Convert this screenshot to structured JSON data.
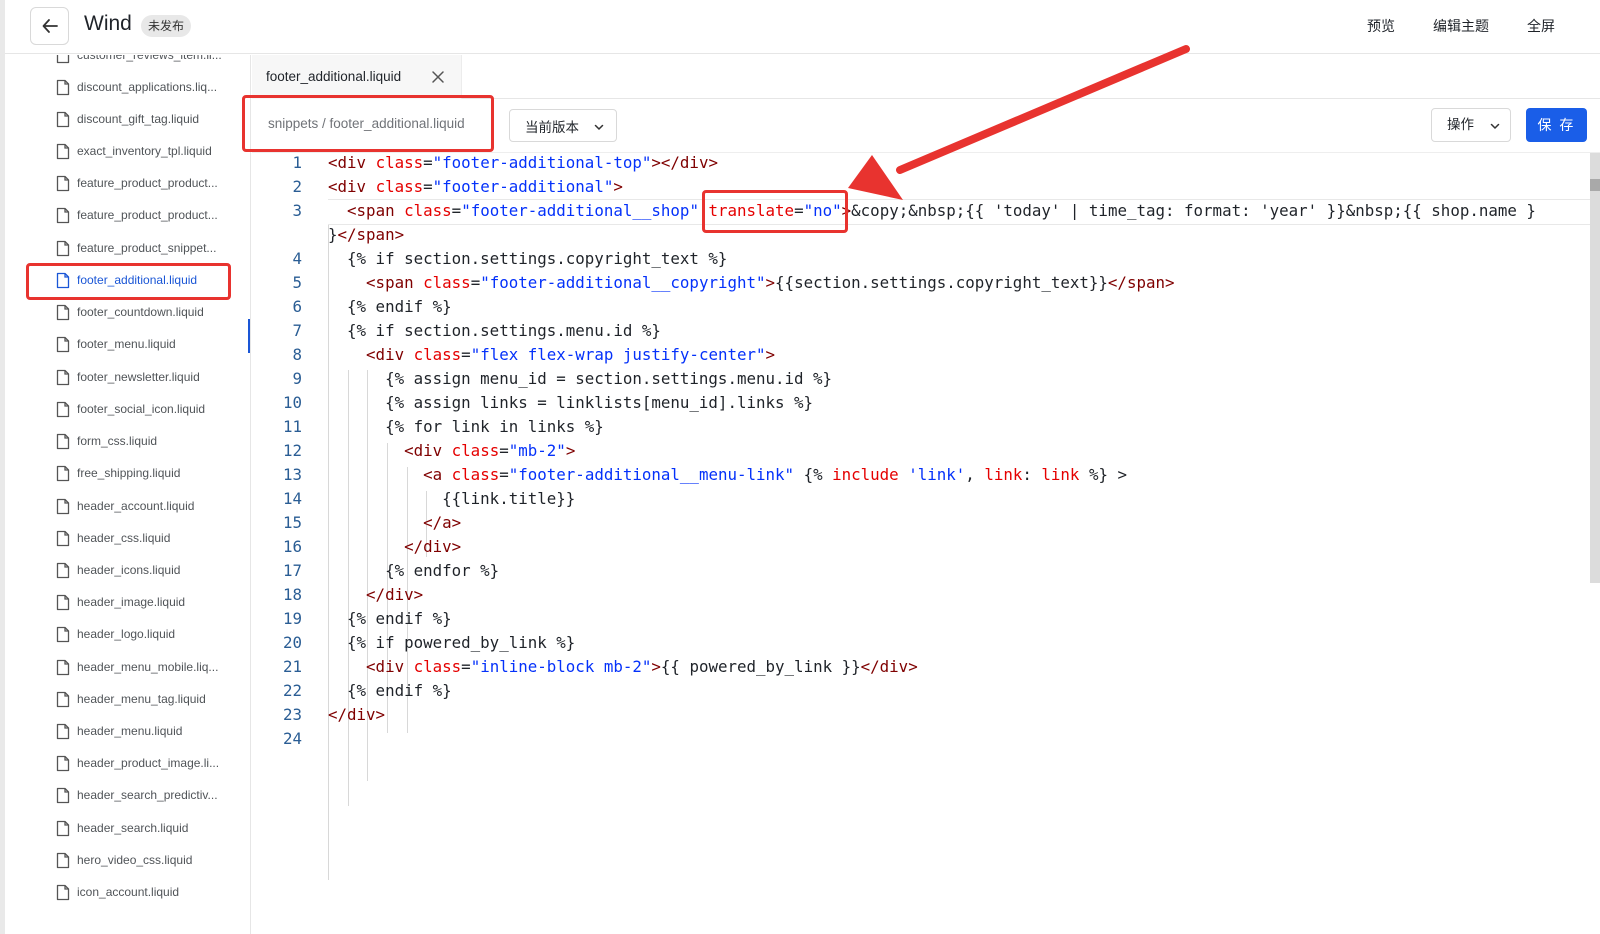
{
  "topbar": {
    "title": "Wind",
    "status_badge": "未发布",
    "actions": [
      "预览",
      "编辑主题",
      "全屏"
    ]
  },
  "sidebar": {
    "items": [
      "customer_reviews_item.li...",
      "discount_applications.liq...",
      "discount_gift_tag.liquid",
      "exact_inventory_tpl.liquid",
      "feature_product_product...",
      "feature_product_product...",
      "feature_product_snippet...",
      "footer_additional.liquid",
      "footer_countdown.liquid",
      "footer_menu.liquid",
      "footer_newsletter.liquid",
      "footer_social_icon.liquid",
      "form_css.liquid",
      "free_shipping.liquid",
      "header_account.liquid",
      "header_css.liquid",
      "header_icons.liquid",
      "header_image.liquid",
      "header_logo.liquid",
      "header_menu_mobile.liq...",
      "header_menu_tag.liquid",
      "header_menu.liquid",
      "header_product_image.li...",
      "header_search_predictiv...",
      "header_search.liquid",
      "hero_video_css.liquid",
      "icon_account.liquid"
    ],
    "active_item": "footer_additional.liquid"
  },
  "editor": {
    "tab_label": "footer_additional.liquid",
    "breadcrumb": "snippets / footer_additional.liquid",
    "version_label": "当前版本",
    "ops_label": "操作",
    "save_label": "保 存",
    "line_numbers": [
      "1",
      "2",
      "3",
      "4",
      "5",
      "6",
      "7",
      "8",
      "9",
      "10",
      "11",
      "12",
      "13",
      "14",
      "15",
      "16",
      "17",
      "18",
      "19",
      "20",
      "21",
      "22",
      "23",
      "24"
    ]
  },
  "colors": {
    "accent": "#1a5ee8",
    "annotation": "#e8332f"
  }
}
